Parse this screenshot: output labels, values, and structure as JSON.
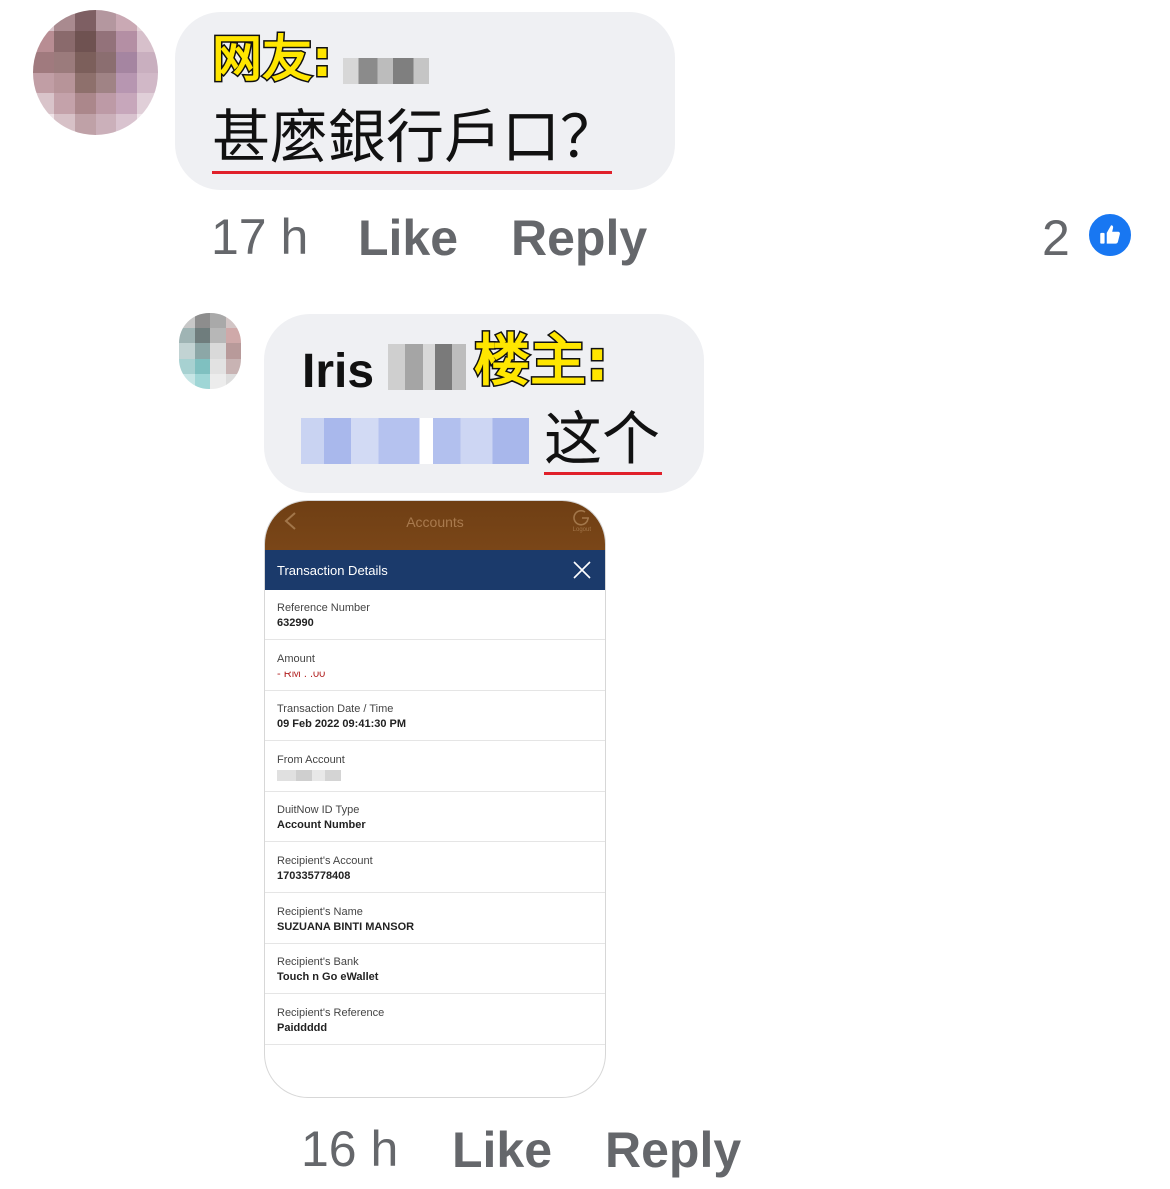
{
  "comments": [
    {
      "label": "网友:",
      "text": "甚麼銀行戶口？",
      "time": "17 h",
      "like_label": "Like",
      "reply_label": "Reply",
      "reaction_count": "2"
    },
    {
      "name": "Iris",
      "label": "楼主:",
      "text": "这个",
      "time": "16 h",
      "like_label": "Like",
      "reply_label": "Reply"
    }
  ],
  "screenshot": {
    "top_title": "Accounts",
    "logout_label": "Logout",
    "header": "Transaction Details",
    "rows": [
      {
        "label": "Reference Number",
        "value": "632990"
      },
      {
        "label": "Amount",
        "value": "- RM   .   .00"
      },
      {
        "label": "Transaction Date / Time",
        "value": "09 Feb 2022 09:41:30 PM"
      },
      {
        "label": "From Account",
        "value": ""
      },
      {
        "label": "DuitNow ID Type",
        "value": "Account Number"
      },
      {
        "label": "Recipient's Account",
        "value": "170335778408"
      },
      {
        "label": "Recipient's Name",
        "value": "SUZUANA BINTI MANSOR"
      },
      {
        "label": "Recipient's Bank",
        "value": "Touch n Go eWallet"
      },
      {
        "label": "Recipient's Reference",
        "value": "Paiddddd"
      }
    ]
  },
  "colors": {
    "bubble": "#eff0f3",
    "meta_text": "#65676b",
    "highlight": "#ffe600",
    "underline": "#e0202a",
    "like_blue": "#1877f2",
    "bank_header": "#1b3a6b",
    "bank_topbar": "#7a4618"
  }
}
